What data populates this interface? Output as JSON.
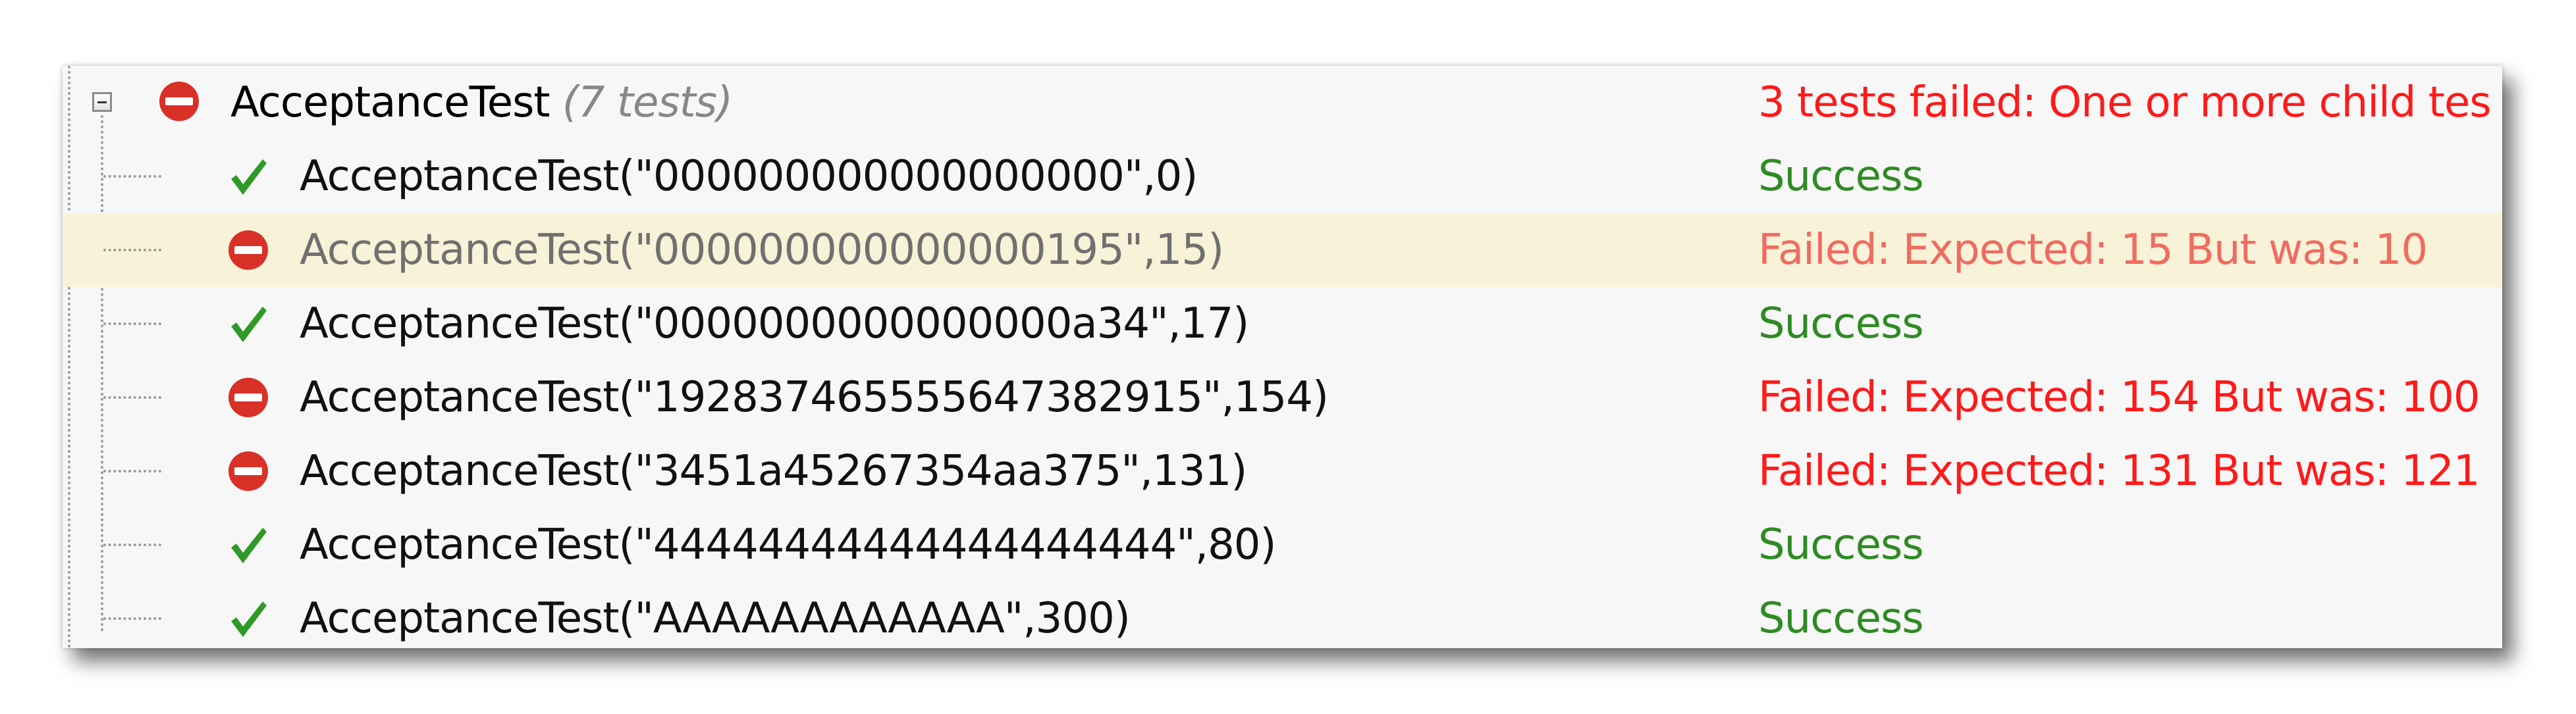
{
  "suite": {
    "name": "AcceptanceTest",
    "count_label": "(7 tests)",
    "status": "3 tests failed: One or more child tes",
    "status_color": "#ff1a1a",
    "icon": "failed-icon"
  },
  "tests": [
    {
      "name": "AcceptanceTest(\"000000000000000000\",0)",
      "status": "Success",
      "icon": "check-icon",
      "status_color": "#2e8b23",
      "highlighted": false
    },
    {
      "name": "AcceptanceTest(\"000000000000000195\",15)",
      "status": "Failed:  Expected: 15 But was: 10",
      "icon": "failed-icon",
      "status_color": "#f06b60",
      "highlighted": true
    },
    {
      "name": "AcceptanceTest(\"0000000000000000a34\",17)",
      "status": "Success",
      "icon": "check-icon",
      "status_color": "#2e8b23",
      "highlighted": false
    },
    {
      "name": "AcceptanceTest(\"192837465555647382915\",154)",
      "status": "Failed:  Expected: 154 But was: 100",
      "icon": "failed-icon",
      "status_color": "#ff1a1a",
      "highlighted": false
    },
    {
      "name": "AcceptanceTest(\"3451a45267354aa375\",131)",
      "status": "Failed:  Expected: 131 But was: 121",
      "icon": "failed-icon",
      "status_color": "#ff1a1a",
      "highlighted": false
    },
    {
      "name": "AcceptanceTest(\"44444444444444444444\",80)",
      "status": "Success",
      "icon": "check-icon",
      "status_color": "#2e8b23",
      "highlighted": false
    },
    {
      "name": "AcceptanceTest(\"AAAAAAAAAAAA\",300)",
      "status": "Success",
      "icon": "check-icon",
      "status_color": "#2e8b23",
      "highlighted": false
    }
  ]
}
